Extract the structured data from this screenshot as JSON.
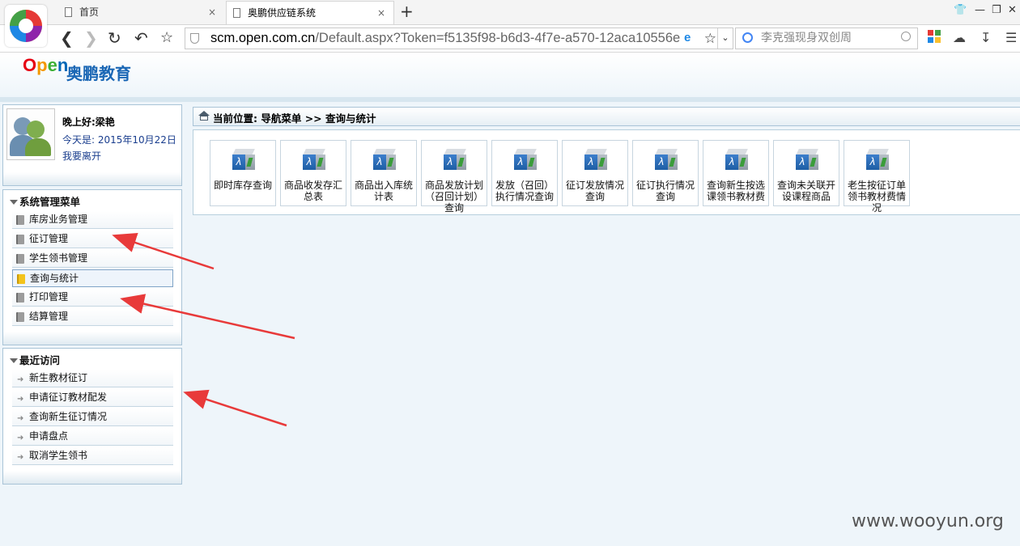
{
  "browser": {
    "tabs": [
      {
        "label": "首页"
      },
      {
        "label": "奥鹏供应链系统"
      }
    ],
    "close_glyph": "×",
    "new_tab_glyph": "+",
    "url_host": "scm.open.com.cn",
    "url_path": "/Default.aspx?Token=f5135f98-b6d3-4f7e-a570-12aca10556e",
    "search_placeholder": "李克强现身双创周",
    "icons": [
      "back-icon",
      "forward-icon",
      "reload-icon",
      "undo-icon",
      "bookmark-star-icon",
      "shield-icon",
      "ie-engine-icon",
      "search-icon",
      "apps-icon",
      "cloud-icon",
      "download-icon",
      "menu-icon"
    ]
  },
  "header": {
    "logo_mark": "Open",
    "logo_text": "奥鹏教育"
  },
  "user": {
    "greeting": "晚上好:梁艳",
    "today": "今天是: 2015年10月22日",
    "logout": "我要离开"
  },
  "system_menu": {
    "title": "系统管理菜单",
    "items": [
      {
        "label": "库房业务管理"
      },
      {
        "label": "征订管理"
      },
      {
        "label": "学生领书管理"
      },
      {
        "label": "查询与统计",
        "active": true
      },
      {
        "label": "打印管理"
      },
      {
        "label": "结算管理"
      }
    ]
  },
  "recent": {
    "title": "最近访问",
    "items": [
      {
        "label": "新生教材征订"
      },
      {
        "label": "申请征订教材配发"
      },
      {
        "label": "查询新生征订情况"
      },
      {
        "label": "申请盘点"
      },
      {
        "label": "取消学生领书"
      }
    ]
  },
  "breadcrumb": "当前位置: 导航菜单 >> 查询与统计",
  "tools": [
    {
      "line1": "即时库存查询",
      "line2": "",
      "line3": ""
    },
    {
      "line1": "商品收发存汇",
      "line2": "总表",
      "line3": ""
    },
    {
      "line1": "商品出入库统",
      "line2": "计表",
      "line3": ""
    },
    {
      "line1": "商品发放计划",
      "line2": "（召回计划）",
      "line3": "查询"
    },
    {
      "line1": "发放（召回）",
      "line2": "执行情况查询",
      "line3": ""
    },
    {
      "line1": "征订发放情况",
      "line2": "查询",
      "line3": ""
    },
    {
      "line1": "征订执行情况",
      "line2": "查询",
      "line3": ""
    },
    {
      "line1": "查询新生按选",
      "line2": "课领书教材费",
      "line3": ""
    },
    {
      "line1": "查询未关联开",
      "line2": "设课程商品",
      "line3": ""
    },
    {
      "line1": "老生按征订单",
      "line2": "领书教材费情",
      "line3": "况"
    }
  ],
  "tool_icon_glyph": "λ",
  "accent_color": "#e83a3a",
  "watermark": "www.wooyun.org"
}
